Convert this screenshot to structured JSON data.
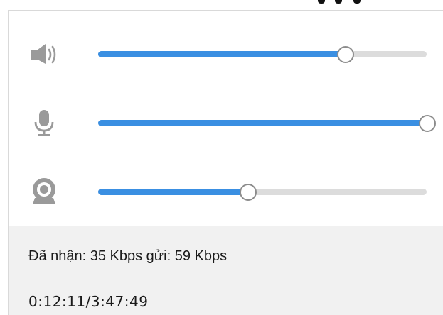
{
  "controls": {
    "speaker": {
      "icon": "speaker-volume-icon",
      "level": 0.75
    },
    "microphone": {
      "icon": "microphone-icon",
      "level": 1.0
    },
    "camera": {
      "icon": "webcam-icon",
      "level": 0.455
    }
  },
  "status": {
    "transfer_text": "Đã nhận: 35 Kbps gửi: 59 Kbps",
    "time_text": "0:12:11/3:47:49"
  },
  "colors": {
    "slider_fill": "#3a8fe2",
    "slider_track": "#dcdcdc",
    "icon_gray": "#9a9a9a",
    "status_background": "#f1f1f1"
  }
}
